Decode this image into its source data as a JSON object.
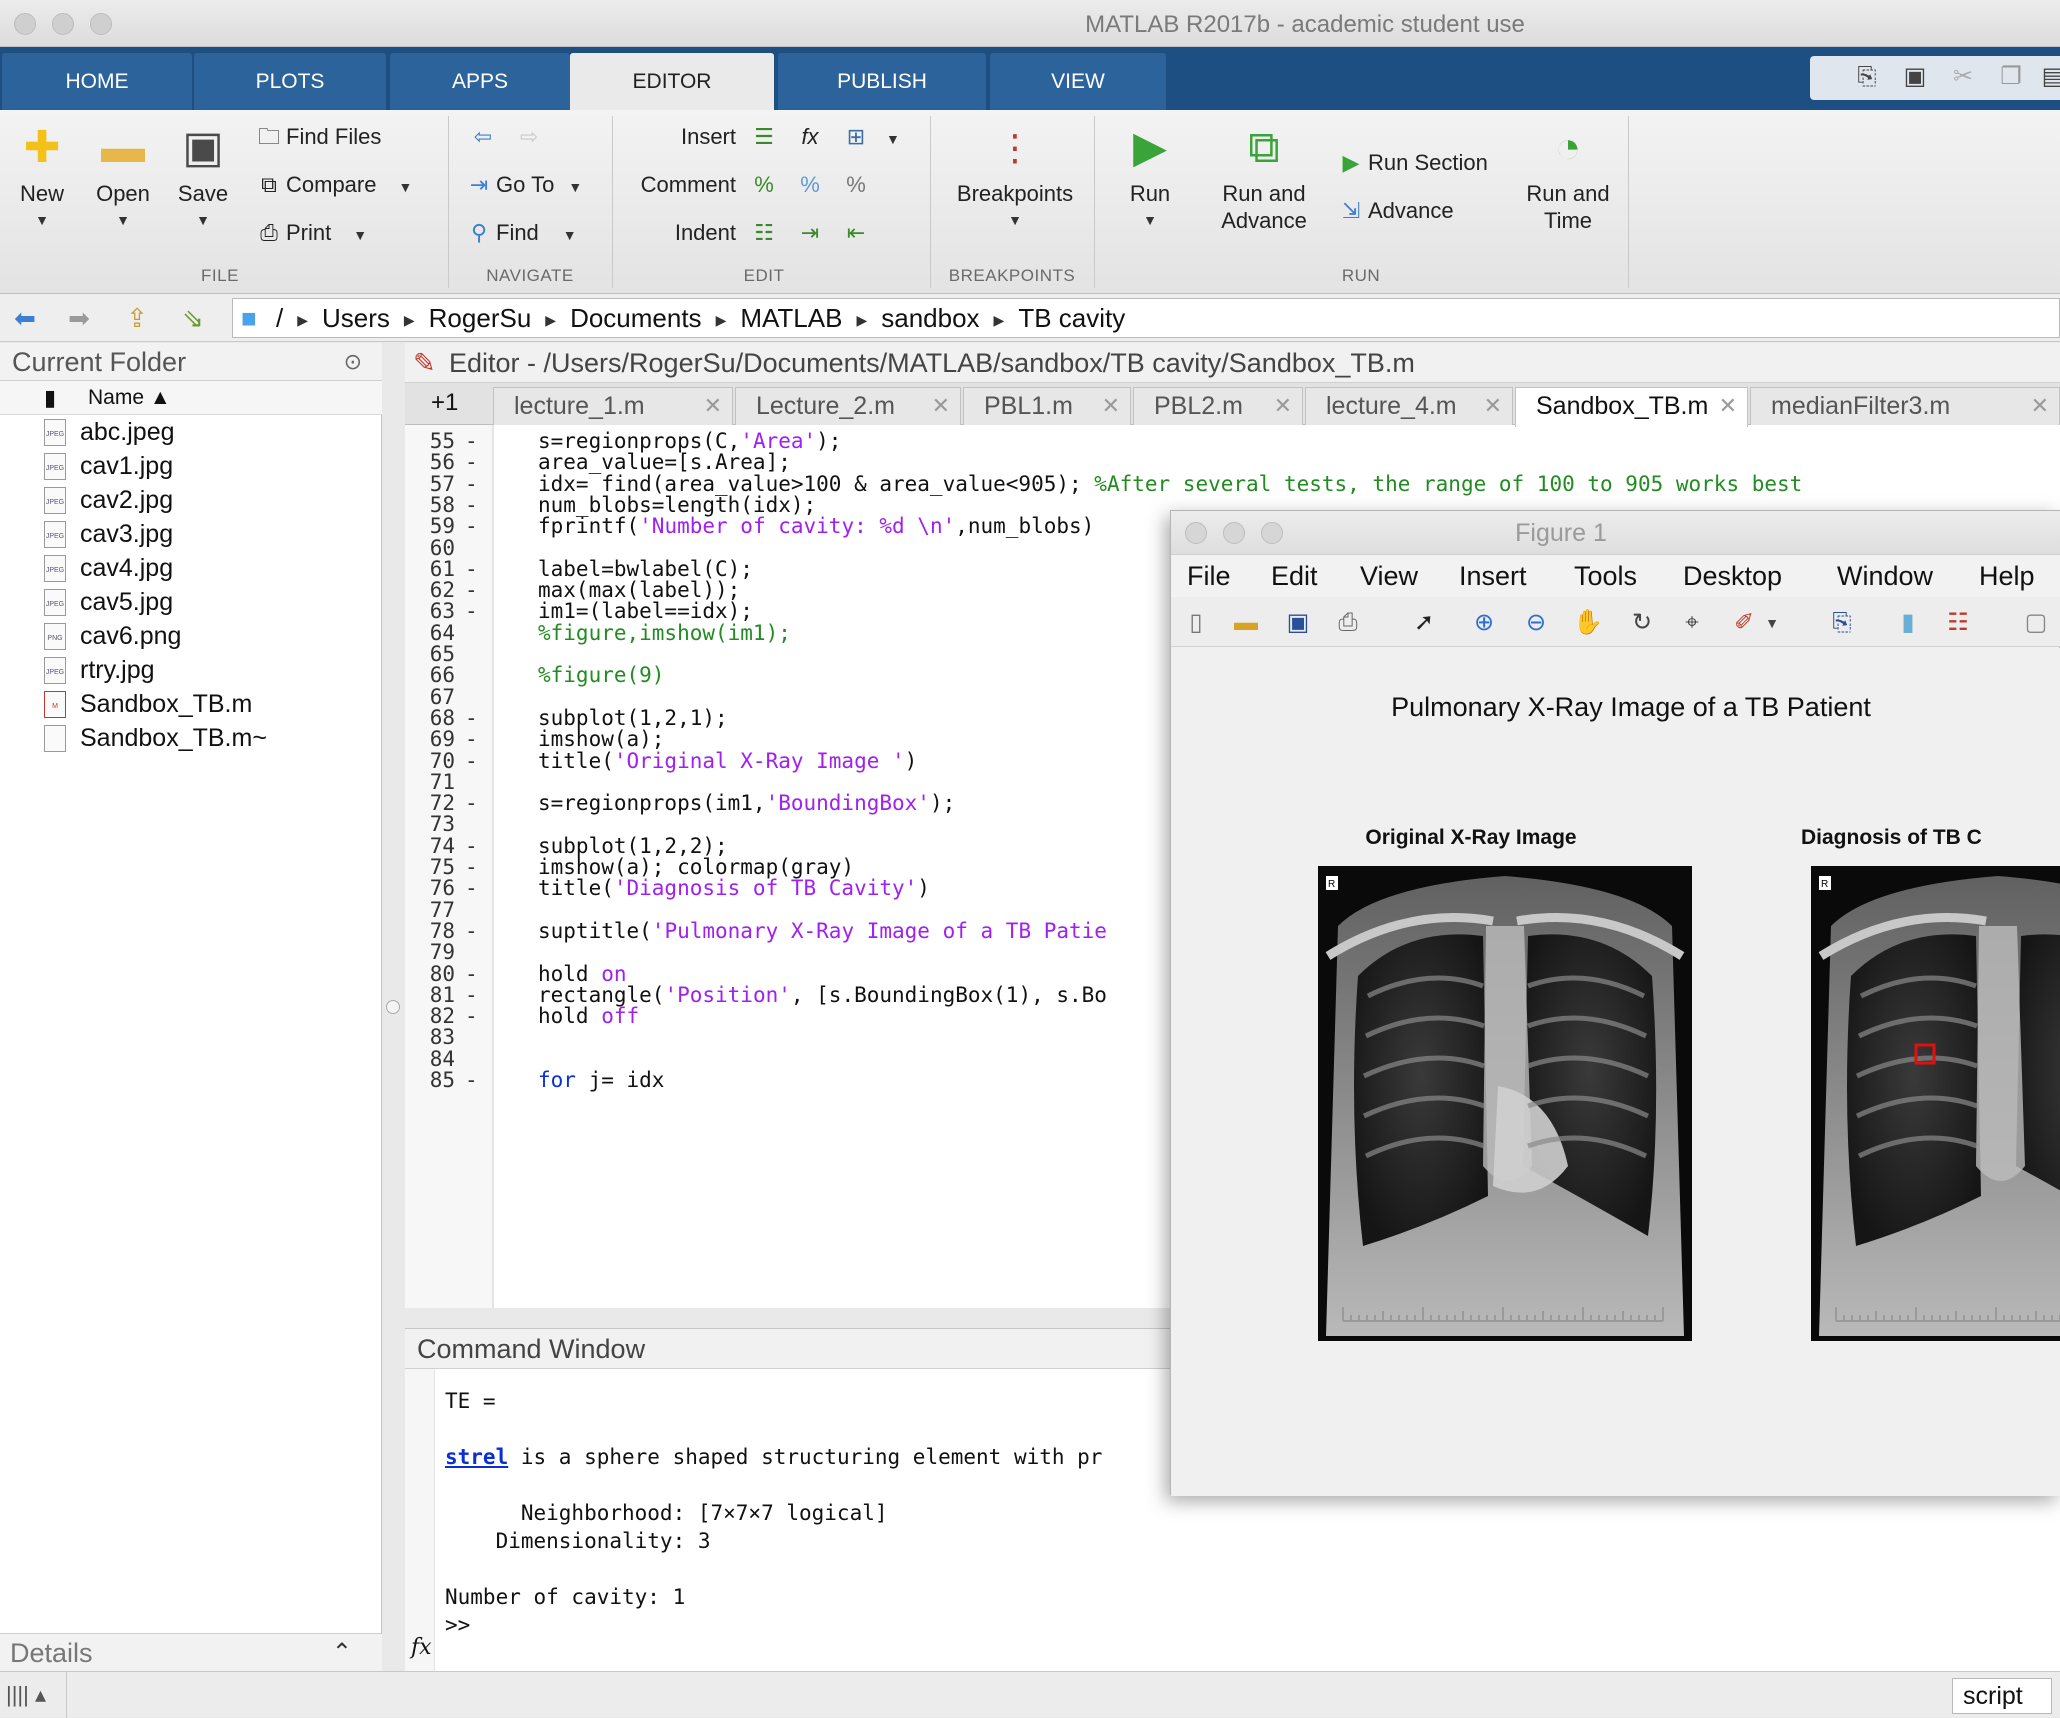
{
  "window": {
    "title": "MATLAB R2017b - academic student use"
  },
  "ribbon_tabs": [
    "HOME",
    "PLOTS",
    "APPS",
    "EDITOR",
    "PUBLISH",
    "VIEW"
  ],
  "ribbon": {
    "file": {
      "new": "New",
      "open": "Open",
      "save": "Save",
      "find_files": "Find Files",
      "compare": "Compare",
      "print": "Print",
      "group": "FILE"
    },
    "navigate": {
      "go_to": "Go To",
      "find": "Find",
      "group": "NAVIGATE"
    },
    "edit": {
      "insert": "Insert",
      "comment": "Comment",
      "indent": "Indent",
      "group": "EDIT"
    },
    "breakpoints": {
      "label": "Breakpoints",
      "group": "BREAKPOINTS"
    },
    "run": {
      "run": "Run",
      "run_advance_1": "Run and",
      "run_advance_2": "Advance",
      "run_section": "Run Section",
      "advance": "Advance",
      "run_time_1": "Run and",
      "run_time_2": "Time",
      "group": "RUN"
    }
  },
  "path": {
    "root": "/",
    "segments": [
      "Users",
      "RogerSu",
      "Documents",
      "MATLAB",
      "sandbox",
      "TB cavity"
    ]
  },
  "current_folder": {
    "title": "Current Folder",
    "column": "Name ▲",
    "files": [
      {
        "name": "abc.jpeg",
        "type": "JPEG"
      },
      {
        "name": "cav1.jpg",
        "type": "JPEG"
      },
      {
        "name": "cav2.jpg",
        "type": "JPEG"
      },
      {
        "name": "cav3.jpg",
        "type": "JPEG"
      },
      {
        "name": "cav4.jpg",
        "type": "JPEG"
      },
      {
        "name": "cav5.jpg",
        "type": "JPEG"
      },
      {
        "name": "cav6.png",
        "type": "PNG"
      },
      {
        "name": "rtry.jpg",
        "type": "JPEG"
      },
      {
        "name": "Sandbox_TB.m",
        "type": "M"
      },
      {
        "name": "Sandbox_TB.m~",
        "type": ""
      }
    ],
    "details": "Details"
  },
  "editor": {
    "title": "Editor - /Users/RogerSu/Documents/MATLAB/sandbox/TB cavity/Sandbox_TB.m",
    "overflow": "+1",
    "tabs": [
      "lecture_1.m",
      "Lecture_2.m",
      "PBL1.m",
      "PBL2.m",
      "lecture_4.m",
      "Sandbox_TB.m",
      "medianFilter3.m"
    ],
    "active_tab": "Sandbox_TB.m",
    "lines": [
      {
        "n": "55",
        "d": "-",
        "t": "s=regionprops(C,<s>'Area'</s>);"
      },
      {
        "n": "56",
        "d": "-",
        "t": "area_value=[s.Area];"
      },
      {
        "n": "57",
        "d": "-",
        "t": "idx= find(area_value>100 & area_value<905); <c>%After several tests, the range of 100 to 905 works best</c>"
      },
      {
        "n": "58",
        "d": "-",
        "t": "num_blobs=length(idx);"
      },
      {
        "n": "59",
        "d": "-",
        "t": "fprintf(<s>'Number of cavity: %d \\n'</s>,num_blobs)"
      },
      {
        "n": "60",
        "d": "",
        "t": ""
      },
      {
        "n": "61",
        "d": "-",
        "t": "label=bwlabel(C);"
      },
      {
        "n": "62",
        "d": "-",
        "t": "max(max(label));"
      },
      {
        "n": "63",
        "d": "-",
        "t": "im1=(label==idx);"
      },
      {
        "n": "64",
        "d": "",
        "t": "<c>%figure,imshow(im1);</c>"
      },
      {
        "n": "65",
        "d": "",
        "t": ""
      },
      {
        "n": "66",
        "d": "",
        "t": "<c>%figure(9)</c>"
      },
      {
        "n": "67",
        "d": "",
        "t": ""
      },
      {
        "n": "68",
        "d": "-",
        "t": "subplot(1,2,1);"
      },
      {
        "n": "69",
        "d": "-",
        "t": "imshow(a);"
      },
      {
        "n": "70",
        "d": "-",
        "t": "title(<s>'Original X-Ray Image '</s>)"
      },
      {
        "n": "71",
        "d": "",
        "t": ""
      },
      {
        "n": "72",
        "d": "-",
        "t": "s=regionprops(im1,<s>'BoundingBox'</s>);"
      },
      {
        "n": "73",
        "d": "",
        "t": ""
      },
      {
        "n": "74",
        "d": "-",
        "t": "subplot(1,2,2);"
      },
      {
        "n": "75",
        "d": "-",
        "t": "imshow(a); colormap(gray)"
      },
      {
        "n": "76",
        "d": "-",
        "t": "title(<s>'Diagnosis of TB Cavity'</s>)"
      },
      {
        "n": "77",
        "d": "",
        "t": ""
      },
      {
        "n": "78",
        "d": "-",
        "t": "suptitle(<s>'Pulmonary X-Ray Image of a TB Patie</s>"
      },
      {
        "n": "79",
        "d": "",
        "t": ""
      },
      {
        "n": "80",
        "d": "-",
        "t": "hold <s>on</s>"
      },
      {
        "n": "81",
        "d": "-",
        "t": "rectangle(<s>'Position'</s>, [s.BoundingBox(1), s.Bo"
      },
      {
        "n": "82",
        "d": "-",
        "t": "hold <s>off</s>"
      },
      {
        "n": "83",
        "d": "",
        "t": ""
      },
      {
        "n": "84",
        "d": "",
        "t": ""
      },
      {
        "n": "85",
        "d": "-",
        "t": "<k>for</k> j= idx"
      }
    ]
  },
  "command_window": {
    "title": "Command Window",
    "lines": [
      "TE =",
      "",
      "<a>strel</a> is a sphere shaped structuring element with pr",
      "",
      "      Neighborhood: [7×7×7 logical]",
      "    Dimensionality: 3",
      "",
      "Number of cavity: 1",
      ">>"
    ],
    "prompt_icon": "fx"
  },
  "status": {
    "mode": "script"
  },
  "figure": {
    "title": "Figure 1",
    "menu": [
      "File",
      "Edit",
      "View",
      "Insert",
      "Tools",
      "Desktop",
      "Window",
      "Help"
    ],
    "suptitle": "Pulmonary X-Ray Image of a TB Patient",
    "axes": [
      {
        "title": "Original X-Ray Image"
      },
      {
        "title": "Diagnosis of TB C"
      }
    ],
    "image_marker": "R"
  }
}
